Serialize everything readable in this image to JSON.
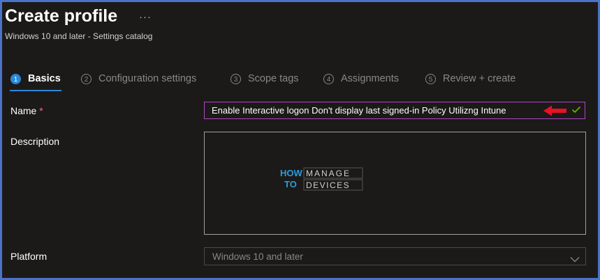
{
  "header": {
    "title": "Create profile",
    "more_label": "···",
    "subtitle": "Windows 10 and later - Settings catalog"
  },
  "tabs": [
    {
      "number": "1",
      "label": "Basics",
      "active": true
    },
    {
      "number": "2",
      "label": "Configuration settings",
      "active": false
    },
    {
      "number": "3",
      "label": "Scope tags",
      "active": false
    },
    {
      "number": "4",
      "label": "Assignments",
      "active": false
    },
    {
      "number": "5",
      "label": "Review + create",
      "active": false
    }
  ],
  "form": {
    "name_label": "Name",
    "required_marker": "*",
    "name_value": "Enable Interactive logon Don't display last signed-in Policy Utilizng Intune",
    "description_label": "Description",
    "platform_label": "Platform",
    "platform_value": "Windows 10 and later"
  },
  "watermark": {
    "line1_left": "HOW",
    "line1_right": "MANAGE",
    "line2_left": "TO",
    "line2_right": "DEVICES"
  },
  "colors": {
    "accent": "#2b88d8",
    "input_focus_border": "#b146c2",
    "arrow": "#e81123",
    "check": "#6bb700"
  }
}
